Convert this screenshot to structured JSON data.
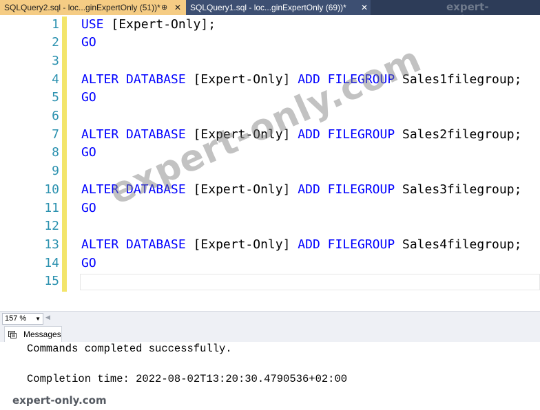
{
  "tabs": [
    {
      "label": "SQLQuery2.sql - loc...ginExpertOnly (51))*",
      "pin": "⊕",
      "close": "✕"
    },
    {
      "label": "SQLQuery1.sql - loc...ginExpertOnly (69))*",
      "close": "✕"
    }
  ],
  "brand_top": "expert-only.com",
  "editor": {
    "line_numbers": [
      "1",
      "2",
      "3",
      "4",
      "5",
      "6",
      "7",
      "8",
      "9",
      "10",
      "11",
      "12",
      "13",
      "14",
      "15"
    ],
    "lines": [
      [
        {
          "t": "USE",
          "k": "kw"
        },
        {
          "t": " [Expert-Only];",
          "k": "id"
        }
      ],
      [
        {
          "t": "GO",
          "k": "kw"
        }
      ],
      [],
      [
        {
          "t": "ALTER DATABASE",
          "k": "kw"
        },
        {
          "t": " [Expert-Only] ",
          "k": "id"
        },
        {
          "t": "ADD FILEGROUP",
          "k": "kw"
        },
        {
          "t": " Sales1filegroup;",
          "k": "id"
        }
      ],
      [
        {
          "t": "GO",
          "k": "kw"
        }
      ],
      [],
      [
        {
          "t": "ALTER DATABASE",
          "k": "kw"
        },
        {
          "t": " [Expert-Only] ",
          "k": "id"
        },
        {
          "t": "ADD FILEGROUP",
          "k": "kw"
        },
        {
          "t": " Sales2filegroup;",
          "k": "id"
        }
      ],
      [
        {
          "t": "GO",
          "k": "kw"
        }
      ],
      [],
      [
        {
          "t": "ALTER DATABASE",
          "k": "kw"
        },
        {
          "t": " [Expert-Only] ",
          "k": "id"
        },
        {
          "t": "ADD FILEGROUP",
          "k": "kw"
        },
        {
          "t": " Sales3filegroup;",
          "k": "id"
        }
      ],
      [
        {
          "t": "GO",
          "k": "kw"
        }
      ],
      [],
      [
        {
          "t": "ALTER DATABASE",
          "k": "kw"
        },
        {
          "t": " [Expert-Only] ",
          "k": "id"
        },
        {
          "t": "ADD FILEGROUP",
          "k": "kw"
        },
        {
          "t": " Sales4filegroup;",
          "k": "id"
        }
      ],
      [
        {
          "t": "GO",
          "k": "kw"
        }
      ],
      []
    ]
  },
  "watermark": "expert-only.com",
  "zoom": {
    "value": "157 %",
    "dropdown_icon": "▼",
    "scroll_icon": "◀"
  },
  "messages_tab": {
    "label": "Messages",
    "icon": "messages-icon"
  },
  "messages": {
    "line1": "Commands completed successfully.",
    "line2": "Completion time: 2022-08-02T13:20:30.4790536+02:00"
  },
  "brand_bottom": "expert-only.com",
  "colors": {
    "keyword": "#0000ff",
    "line_number": "#2b91af",
    "active_tab": "#f5cc84",
    "tabbar": "#2d3c58",
    "change_margin": "#f3e56a"
  }
}
